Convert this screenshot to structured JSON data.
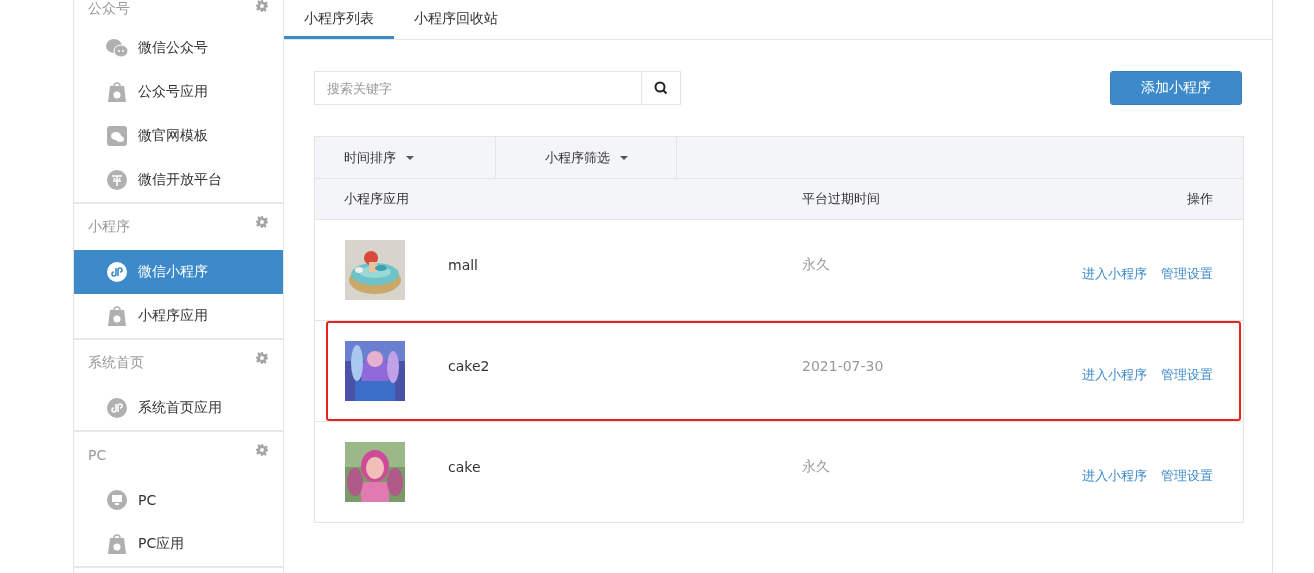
{
  "sidebar": {
    "groups": [
      {
        "title": "公众号",
        "items": [
          {
            "label": "微信公众号",
            "selected": false
          },
          {
            "label": "公众号应用",
            "selected": false
          },
          {
            "label": "微官网模板",
            "selected": false
          },
          {
            "label": "微信开放平台",
            "selected": false
          }
        ]
      },
      {
        "title": "小程序",
        "items": [
          {
            "label": "微信小程序",
            "selected": true
          },
          {
            "label": "小程序应用",
            "selected": false
          }
        ]
      },
      {
        "title": "系统首页",
        "items": [
          {
            "label": "系统首页应用",
            "selected": false
          }
        ]
      },
      {
        "title": "PC",
        "items": [
          {
            "label": "PC",
            "selected": false
          },
          {
            "label": "PC应用",
            "selected": false
          }
        ]
      }
    ]
  },
  "tabs": [
    {
      "label": "小程序列表",
      "selected": true
    },
    {
      "label": "小程序回收站",
      "selected": false
    }
  ],
  "search": {
    "placeholder": "搜索关键字"
  },
  "add_button": "添加小程序",
  "filters": [
    "时间排序",
    "小程序筛选"
  ],
  "table": {
    "columns": [
      "小程序应用",
      "平台过期时间",
      "操作"
    ],
    "rows": [
      {
        "name": "mall",
        "expiry": "永久",
        "annotated": false,
        "actions": [
          "进入小程序",
          "管理设置"
        ]
      },
      {
        "name": "cake2",
        "expiry": "2021-07-30",
        "annotated": true,
        "actions": [
          "进入小程序",
          "管理设置"
        ]
      },
      {
        "name": "cake",
        "expiry": "永久",
        "annotated": false,
        "actions": [
          "进入小程序",
          "管理设置"
        ]
      }
    ]
  }
}
